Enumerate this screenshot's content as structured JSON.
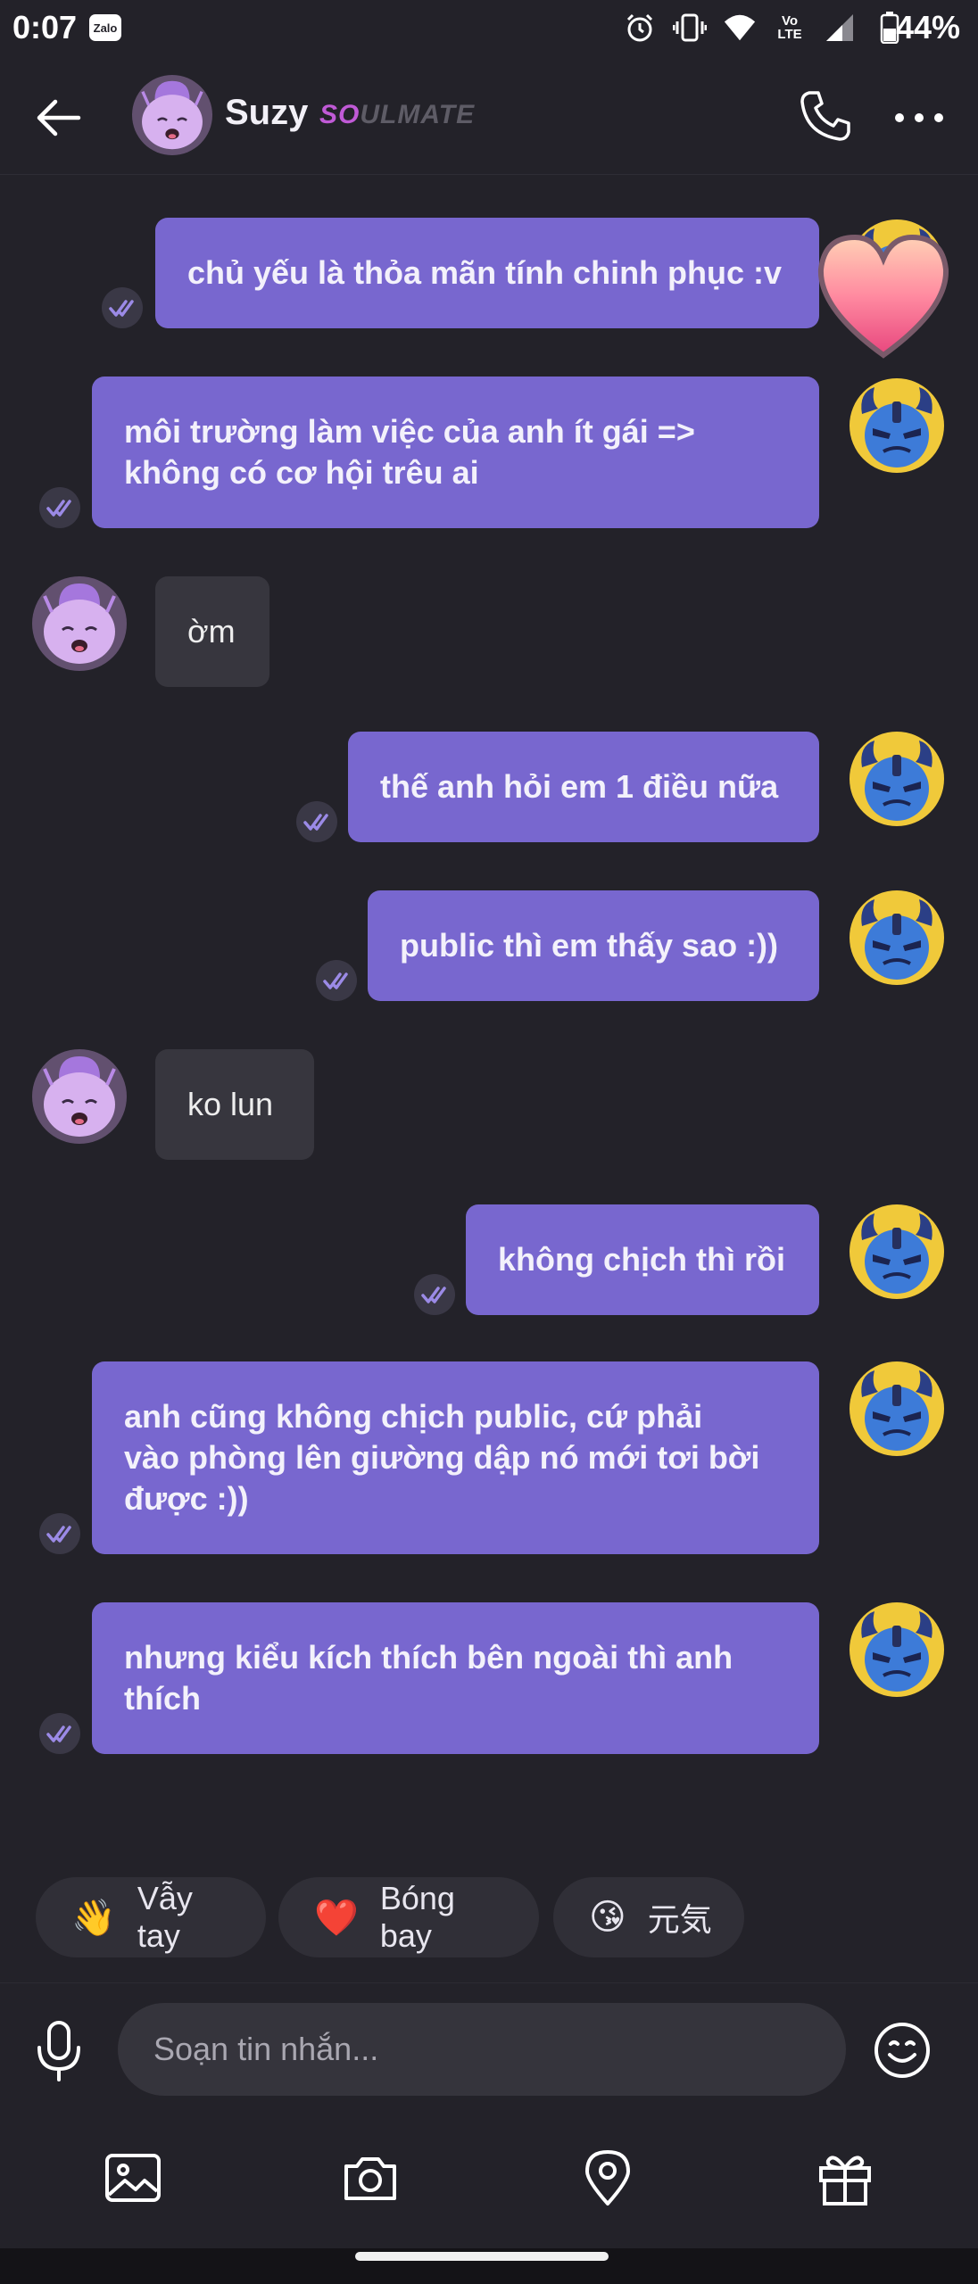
{
  "status_bar": {
    "time": "0:07",
    "zalo_badge": "Zalo",
    "network_label_top": "Vo",
    "network_label_bottom": "LTE",
    "battery_percent": "44%",
    "icons": [
      "alarm-icon",
      "vibrate-icon",
      "wifi-icon",
      "volte-icon",
      "signal-icon",
      "battery-icon"
    ]
  },
  "header": {
    "contact_name": "Suzy",
    "brand_prefix": "SO",
    "brand_suffix": "ULMATE"
  },
  "messages": [
    {
      "sender": "me",
      "text": "chủ yếu là thỏa mãn tính chinh phục :v"
    },
    {
      "sender": "me",
      "text": "môi trường làm việc của anh ít gái =>\nkhông có cơ hội trêu ai"
    },
    {
      "sender": "them",
      "text": "ờm"
    },
    {
      "sender": "me",
      "text": "thế anh hỏi em 1 điều nữa"
    },
    {
      "sender": "me",
      "text": "public thì em thấy sao :))"
    },
    {
      "sender": "them",
      "text": "ko lun"
    },
    {
      "sender": "me",
      "text": "không chịch thì rồi"
    },
    {
      "sender": "me",
      "text": "anh cũng không chịch public, cứ phải\nvào phòng lên giường dập nó mới tơi bời\nđược :))"
    },
    {
      "sender": "me",
      "text": "nhưng kiểu kích thích bên ngoài thì anh\nthích"
    }
  ],
  "quick_reactions": [
    {
      "emoji": "👋",
      "label": "Vẫy tay"
    },
    {
      "emoji": "❤️",
      "label": "Bóng bay"
    },
    {
      "emoji": "😘",
      "label": "元気"
    }
  ],
  "composer": {
    "placeholder": "Soạn tin nhắn..."
  },
  "toolbar": {
    "icons": [
      "gallery-icon",
      "camera-icon",
      "location-icon",
      "gift-icon"
    ]
  },
  "colors": {
    "background": "#232229",
    "outgoing_bubble": "#7867cf",
    "incoming_bubble": "#37363e",
    "brand_accent": "#c05ad6"
  }
}
